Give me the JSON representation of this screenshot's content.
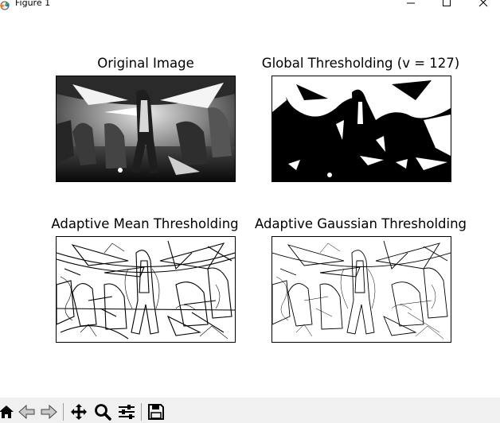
{
  "window": {
    "title": "Figure 1"
  },
  "subplots": [
    {
      "title": "Original Image",
      "content": "grayscale image"
    },
    {
      "title": "Global Thresholding (v = 127)",
      "content": "binary threshold image"
    },
    {
      "title": "Adaptive Mean Thresholding",
      "content": "adaptive mean threshold image"
    },
    {
      "title": "Adaptive Gaussian Thresholding",
      "content": "adaptive gaussian threshold image"
    }
  ],
  "toolbar": {
    "items": [
      {
        "icon": "home-icon"
      },
      {
        "icon": "back-arrow-icon"
      },
      {
        "icon": "forward-arrow-icon"
      },
      {
        "icon": "pan-move-icon"
      },
      {
        "icon": "zoom-magnifier-icon"
      },
      {
        "icon": "configure-subplots-icon"
      },
      {
        "icon": "save-floppy-icon"
      }
    ]
  },
  "colors": {
    "toolbar_bg": "#f0f0f0",
    "figure_bg": "#ffffff",
    "frame": "#000000"
  }
}
